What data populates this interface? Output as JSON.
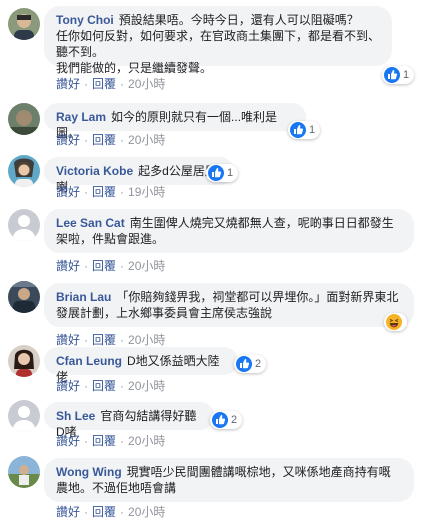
{
  "labels": {
    "like": "讚好",
    "reply": "回覆"
  },
  "comments": [
    {
      "author": "Tony Choi",
      "text": "預設結果唔。今時今日，還有人可以阻礙嗎？\n任你如何反對，如何要求，在官政商土集團下，都是看不到、聽不到。\n我們能做的，只是繼續發聲。",
      "time": "20小時",
      "reaction": {
        "type": "like",
        "count": "1"
      }
    },
    {
      "author": "Ray Lam",
      "text": "如今的原則就只有一個...唯利是圖。",
      "time": "20小時",
      "reaction": {
        "type": "like",
        "count": "1"
      }
    },
    {
      "author": "Victoria Kobe",
      "text": "起多d公屋居屋喇",
      "time": "19小時",
      "reaction": {
        "type": "like",
        "count": "1"
      }
    },
    {
      "author": "Lee San Cat",
      "text": "南生圍俾人燒完又燒都無人查，呢啲事日日都發生架啦，件點會跟進。",
      "time": "20小時",
      "reaction": null
    },
    {
      "author": "Brian Lau",
      "text": "「你賠夠錢畀我，祠堂都可以畀埋你。」面對新界東北發展計劃，上水鄉事委員會主席侯志強說",
      "time": "20小時",
      "reaction": {
        "type": "haha",
        "count": ""
      }
    },
    {
      "author": "Cfan Leung",
      "text": "D地又係益晒大陸佬",
      "time": "20小時",
      "reaction": {
        "type": "like",
        "count": "2"
      }
    },
    {
      "author": "Sh Lee",
      "text": "官商勾結講得好聽D啫",
      "time": "20小時",
      "reaction": {
        "type": "like",
        "count": "2"
      }
    },
    {
      "author": "Wong Wing",
      "text": "現實唔少民間團體講嘅棕地，又咪係地產商持有嘅農地。不過佢地唔會講",
      "time": "20小時",
      "reaction": null
    }
  ]
}
